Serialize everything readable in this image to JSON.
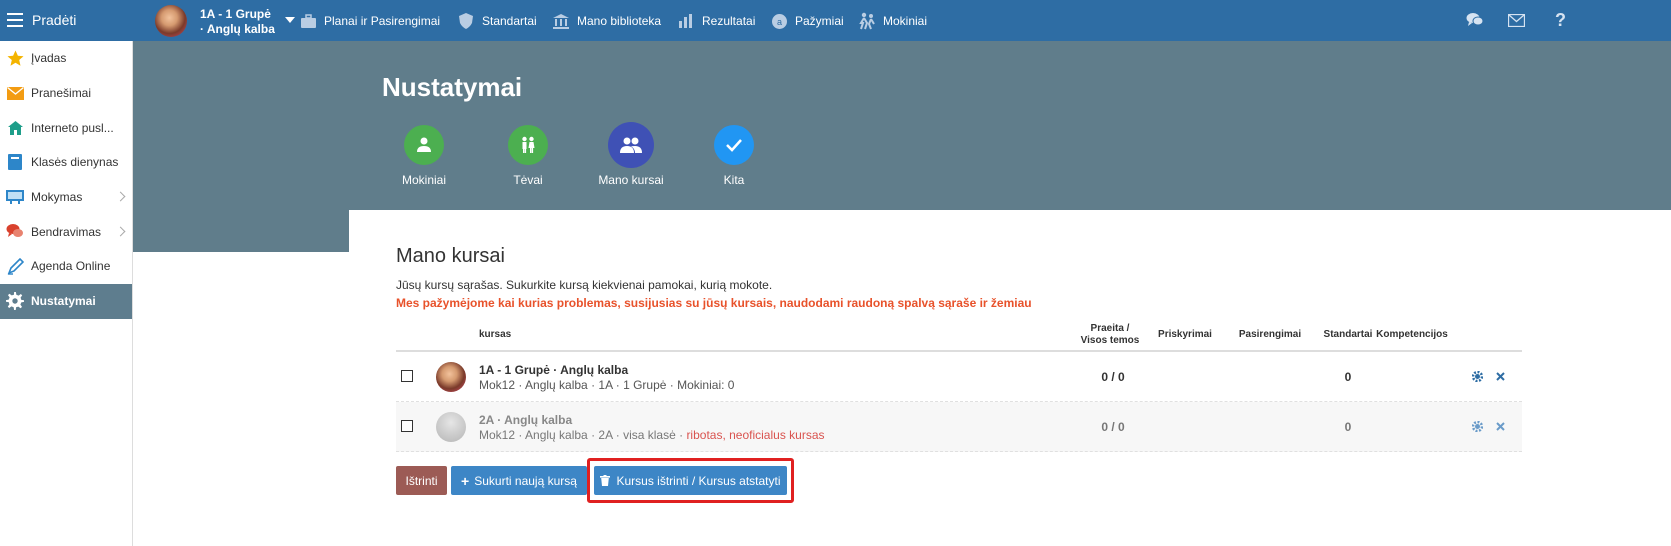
{
  "topbar": {
    "brand": "Pradėti",
    "course_line1": "1A - 1 Grupė",
    "course_line2": "· Anglų kalba",
    "nav": [
      {
        "label": "Planai ir Pasirengimai",
        "icon": "briefcase-icon"
      },
      {
        "label": "Standartai",
        "icon": "shield-icon"
      },
      {
        "label": "Mano biblioteka",
        "icon": "library-icon"
      },
      {
        "label": "Rezultatai",
        "icon": "bar-chart-icon"
      },
      {
        "label": "Pažymiai",
        "icon": "grades-icon"
      },
      {
        "label": "Mokiniai",
        "icon": "students-icon"
      }
    ],
    "right_icons": [
      "chat-icon",
      "mail-icon",
      "help-icon"
    ],
    "help_glyph": "?"
  },
  "sidebar": {
    "items": [
      {
        "label": "Įvadas",
        "icon": "star-icon"
      },
      {
        "label": "Pranešimai",
        "icon": "envelope-icon"
      },
      {
        "label": "Interneto pusl...",
        "icon": "home-icon"
      },
      {
        "label": "Klasės dienynas",
        "icon": "book-icon"
      },
      {
        "label": "Mokymas",
        "icon": "classroom-icon"
      },
      {
        "label": "Bendravimas",
        "icon": "speech-icon"
      },
      {
        "label": "Agenda Online",
        "icon": "pen-icon"
      },
      {
        "label": "Nustatymai",
        "icon": "gear-icon"
      }
    ]
  },
  "header": {
    "title": "Nustatymai",
    "tiles": [
      {
        "label": "Mokiniai",
        "color": "#4caf50"
      },
      {
        "label": "Tėvai",
        "color": "#4caf50"
      },
      {
        "label": "Mano kursai",
        "color": "#3f51b5"
      },
      {
        "label": "Kita",
        "color": "#2196f3"
      }
    ]
  },
  "main": {
    "title": "Mano kursai",
    "description": "Jūsų kursų sąrašas. Sukurkite kursą kiekvienai pamokai, kurią mokote.",
    "warning": "Mes pažymėjome kai kurias problemas, susijusias su jūsų kursais, naudodami raudoną spalvą sąraše ir žemiau",
    "columns": {
      "course": "kursas",
      "passed_line1": "Praeita /",
      "passed_line2": "Visos temos",
      "assignments": "Priskyrimai",
      "preparations": "Pasirengimai",
      "standards": "Standartai",
      "competencies": "Kompetencijos"
    },
    "rows": [
      {
        "name": "1A - 1 Grupė · Anglų kalba",
        "sub": "Mok12 · Anglų kalba · 1A · 1 Grupė · Mokiniai: 0",
        "sub_warn": "",
        "passed": "0 / 0",
        "standards": "0"
      },
      {
        "name": "2A · Anglų kalba",
        "sub": "Mok12 · Anglų kalba · 2A · visa klasė ·",
        "sub_warn": "ribotas, neoficialus kursas",
        "passed": "0 / 0",
        "standards": "0"
      }
    ],
    "buttons": {
      "delete": "Ištrinti",
      "create": "Sukurti naują kursą",
      "restore": "Kursus ištrinti / Kursus atstatyti"
    }
  },
  "colors": {
    "topbar": "#2e6da4",
    "header_band": "#607d8b",
    "warning": "#e8522b",
    "delete_button": "#9c5b55",
    "primary_button": "#3d86c6",
    "highlight_box": "#e02020"
  }
}
